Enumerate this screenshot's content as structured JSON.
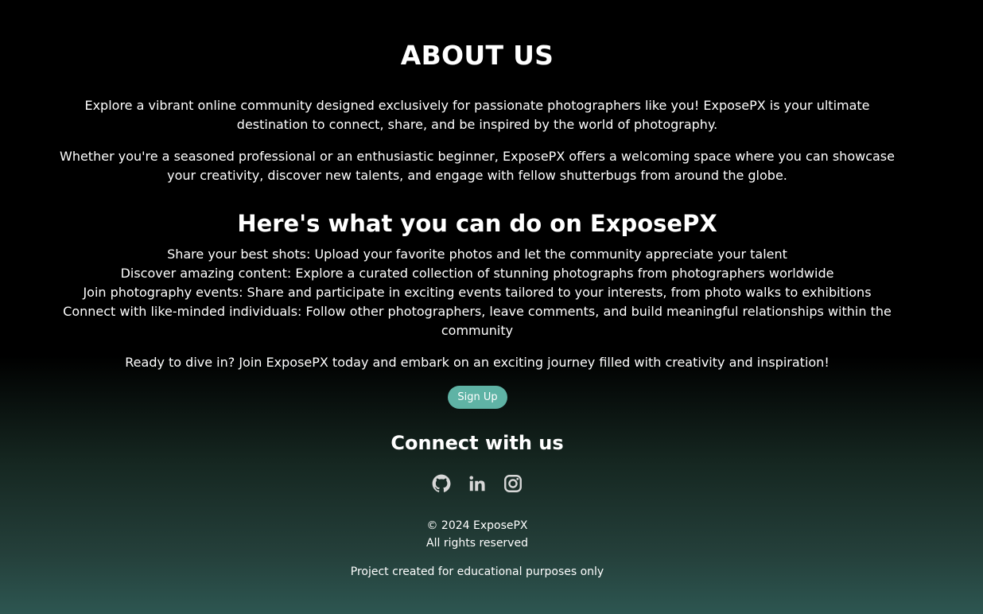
{
  "about": {
    "title": "ABOUT US",
    "paragraph_1": "Explore a vibrant online community designed exclusively for passionate photographers like you! ExposePX is your ultimate destination to connect, share, and be inspired by the world of photography.",
    "paragraph_2": "Whether you're a seasoned professional or an enthusiastic beginner, ExposePX offers a welcoming space where you can showcase your creativity, discover new talents, and engage with fellow shutterbugs from around the globe."
  },
  "features": {
    "title": "Here's what you can do on ExposePX",
    "items": [
      "Share your best shots: Upload your favorite photos and let the community appreciate your talent",
      "Discover amazing content: Explore a curated collection of stunning photographs from photographers worldwide",
      "Join photography events: Share and participate in exciting events tailored to your interests, from photo walks to exhibitions",
      "Connect with like-minded individuals: Follow other photographers, leave comments, and build meaningful relationships within the community"
    ]
  },
  "cta": {
    "text": "Ready to dive in? Join ExposePX today and embark on an exciting journey filled with creativity and inspiration!",
    "button_label": "Sign Up",
    "button_color": "#5fb3a5"
  },
  "footer": {
    "connect_title": "Connect with us",
    "social_icons": [
      "github-icon",
      "linkedin-icon",
      "instagram-icon"
    ],
    "copyright": "© 2024 ExposePX",
    "rights": "All rights reserved",
    "note": "Project created for educational purposes only"
  }
}
